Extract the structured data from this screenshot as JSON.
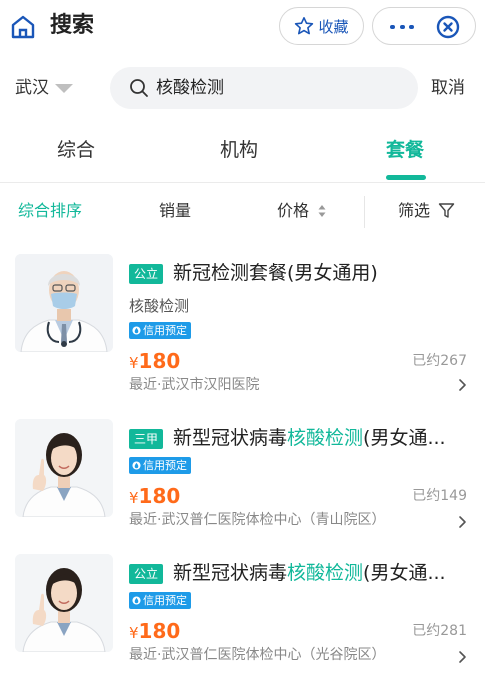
{
  "header": {
    "title": "搜索",
    "favorite_label": "收藏",
    "colors": {
      "accent_blue": "#1a56b8"
    }
  },
  "search": {
    "city": "武汉",
    "query": "核酸检测",
    "cancel_label": "取消"
  },
  "tabs": [
    {
      "label": "综合",
      "active": false
    },
    {
      "label": "机构",
      "active": false
    },
    {
      "label": "套餐",
      "active": true
    }
  ],
  "sort": {
    "comprehensive": "综合排序",
    "sales": "销量",
    "price": "价格",
    "filter": "筛选"
  },
  "colors": {
    "accent": "#12b89a",
    "price": "#ff6a1a",
    "credit_badge": "#1e9be8"
  },
  "products": [
    {
      "badge": "公立",
      "name_parts": [
        "新冠检测套餐(男女通用)",
        "",
        ""
      ],
      "sub": "核酸检测",
      "credit": "信用预定",
      "currency": "¥",
      "price": "180",
      "sold": "已约267",
      "hospital": "最近·武汉市汉阳医院",
      "image": "male-doctor-photo"
    },
    {
      "badge": "三甲",
      "name_parts": [
        "新型冠状病毒",
        "核酸检测",
        "(男女通..."
      ],
      "sub": "",
      "credit": "信用预定",
      "currency": "¥",
      "price": "180",
      "sold": "已约149",
      "hospital": "最近·武汉普仁医院体检中心（青山院区）",
      "image": "female-doctor-photo"
    },
    {
      "badge": "公立",
      "name_parts": [
        "新型冠状病毒",
        "核酸检测",
        "(男女通..."
      ],
      "sub": "",
      "credit": "信用预定",
      "currency": "¥",
      "price": "180",
      "sold": "已约281",
      "hospital": "最近·武汉普仁医院体检中心（光谷院区）",
      "image": "female-doctor-photo"
    }
  ]
}
